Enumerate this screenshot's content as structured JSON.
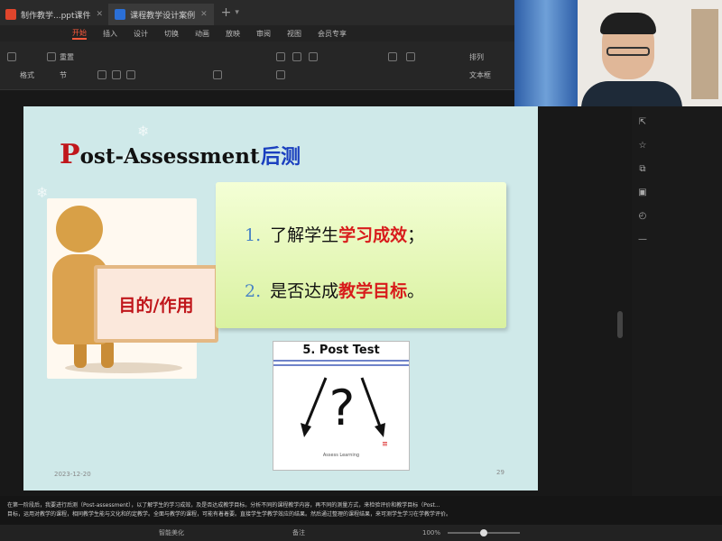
{
  "tabs": [
    {
      "label": "制作教学...ppt课件",
      "icon_color": "#e0452c",
      "active": false
    },
    {
      "label": "课程教学设计案例",
      "icon_color": "#2b6fd6",
      "active": true
    }
  ],
  "ribbon": {
    "tabs": [
      "开始",
      "插入",
      "设计",
      "切换",
      "动画",
      "放映",
      "审阅",
      "视图",
      "会员专享"
    ],
    "active_index": 0,
    "tools": {
      "reset": "重置",
      "format": "格式",
      "section": "节",
      "arrange": "排列",
      "textbox": "文本框"
    }
  },
  "slide": {
    "title_first": "P",
    "title_rest": "ost-Assessment",
    "title_cn": "后测",
    "sign_text": "目的/作用",
    "point1": {
      "num": "1.",
      "text": "了解学生",
      "highlight": "学习成效",
      "end": "；"
    },
    "point2": {
      "num": "2.",
      "text": "是否达成",
      "highlight": "教学目标",
      "end": "。"
    },
    "posttest_title": "5. Post Test",
    "posttest_credit": "Assess Learning",
    "date": "2023-12-20",
    "page_number": "29"
  },
  "notes": {
    "line1": "在第一阶段后，我要进行后测（Post-assessment），以了解学生的学习成效，及是否达成教学目标。分析不同的课程教学内容，再不同的测量方式，来检验评价和教学目标（Post...",
    "line2": "目标，运用对教学的课程，相同教学生能与文化和的定教学。全面与教学的课程，可能有着着要。直接学生学教学效应的结果。然后通过整理的课程结果，来可测学生学习在学教学评价。"
  },
  "status": {
    "left": "智能美化",
    "mid": "备注",
    "zoom": "100%",
    "zoom_fraction": 0.5
  },
  "colors": {
    "accent": "#ff5a3c",
    "slide_bg": "#cfe9e9",
    "title_cn": "#1a3fbf",
    "highlight": "#d81b1b"
  },
  "icons": {
    "right_bar": [
      "cursor-icon",
      "star-icon",
      "copy-icon",
      "layout-icon",
      "history-icon",
      "more-icon"
    ]
  }
}
